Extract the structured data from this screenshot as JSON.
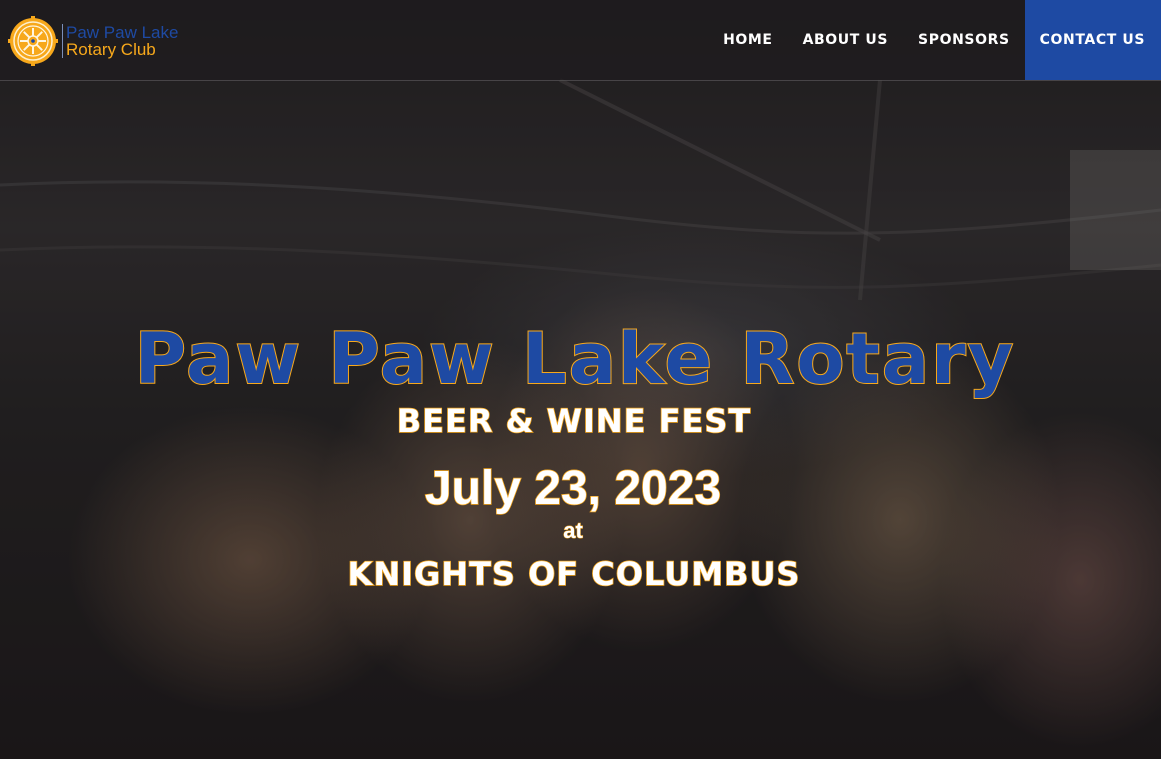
{
  "logo": {
    "line1": "Paw Paw Lake",
    "line2": "Rotary Club",
    "icon": "rotary-wheel-icon"
  },
  "nav": {
    "items": [
      {
        "label": "HOME"
      },
      {
        "label": "ABOUT US"
      },
      {
        "label": "SPONSORS"
      },
      {
        "label": "CONTACT US",
        "active": true
      }
    ]
  },
  "hero": {
    "title": "Paw Paw Lake Rotary",
    "subtitle": "BEER & WINE FEST",
    "date": "July 23, 2023",
    "at": "at",
    "venue": "KNIGHTS OF COLUMBUS"
  },
  "colors": {
    "brand_blue": "#1e4aa3",
    "brand_gold": "#f7a81b",
    "header_bg": "#1e1c1e"
  }
}
